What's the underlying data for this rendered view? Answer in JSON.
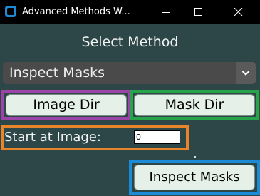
{
  "window": {
    "title": "Advanced Methods W...",
    "icons": {
      "minimize": "minimize-icon",
      "maximize": "maximize-icon",
      "close": "close-icon"
    }
  },
  "main": {
    "heading": "Select Method",
    "method_select": {
      "value": "Inspect Masks",
      "icon": "chevron-down-icon"
    },
    "image_dir_label": "Image Dir",
    "mask_dir_label": "Mask Dir",
    "start_label": "Start at Image:",
    "start_value": "0",
    "inspect_label": "Inspect Masks"
  },
  "colors": {
    "background": "#2d4748",
    "highlight_purple": "#9d44a8",
    "highlight_green": "#27a349",
    "highlight_orange": "#e8852a",
    "highlight_blue": "#1b8bd8",
    "button": "#e4f0e8"
  }
}
